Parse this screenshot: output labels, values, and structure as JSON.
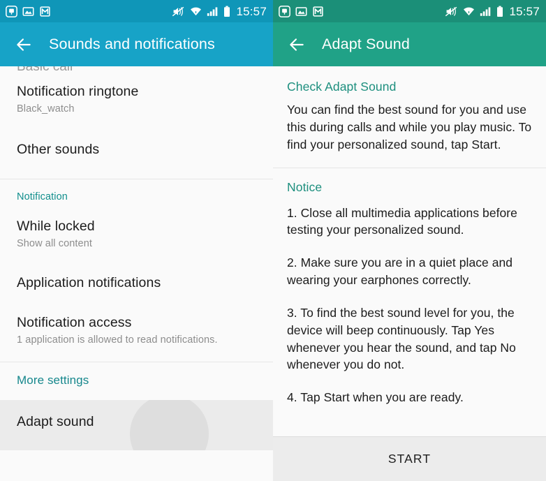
{
  "left_screen": {
    "status_bar": {
      "time": "15:57",
      "icons": [
        "app-notification-icon",
        "photo-icon",
        "gmail-icon",
        "mute-icon",
        "wifi-icon",
        "signal-icon",
        "battery-icon"
      ],
      "background_color": "#0f96b8"
    },
    "action_bar": {
      "title": "Sounds and notifications",
      "back_label": "Back",
      "background_color": "#17a3c7"
    },
    "partial_top_item": "Basic call",
    "sections": [
      {
        "header": null,
        "rows": [
          {
            "title": "Notification ringtone",
            "subtitle": "Black_watch"
          },
          {
            "title": "Other sounds",
            "subtitle": null
          }
        ]
      },
      {
        "header": "Notification",
        "rows": [
          {
            "title": "While locked",
            "subtitle": "Show all content"
          },
          {
            "title": "Application notifications",
            "subtitle": null
          },
          {
            "title": "Notification access",
            "subtitle": "1 application is allowed to read notifications."
          }
        ]
      }
    ],
    "more_settings_link": "More settings",
    "pressed_row": {
      "title": "Adapt sound"
    },
    "accent_color": "#16878c"
  },
  "right_screen": {
    "status_bar": {
      "time": "15:57",
      "icons": [
        "app-notification-icon",
        "photo-icon",
        "gmail-icon",
        "mute-icon",
        "wifi-icon",
        "signal-icon",
        "battery-icon"
      ],
      "background_color": "#1b8f78"
    },
    "action_bar": {
      "title": "Adapt Sound",
      "back_label": "Back",
      "background_color": "#20a287"
    },
    "check_block": {
      "header": "Check Adapt Sound",
      "body": "You can find the best sound for you and use this during calls and while you play music. To find your personalized sound, tap Start."
    },
    "notice_block": {
      "header": "Notice",
      "items": [
        "1. Close all multimedia applications before testing your personalized sound.",
        "2. Make sure you are in a quiet place and wearing your earphones correctly.",
        "3. To find the best sound level for you, the device will beep continuously. Tap Yes whenever you hear the sound, and tap No whenever you do not.",
        "4. Tap Start when you are ready."
      ]
    },
    "start_button": {
      "label": "START"
    },
    "accent_color": "#1d8f7e"
  }
}
